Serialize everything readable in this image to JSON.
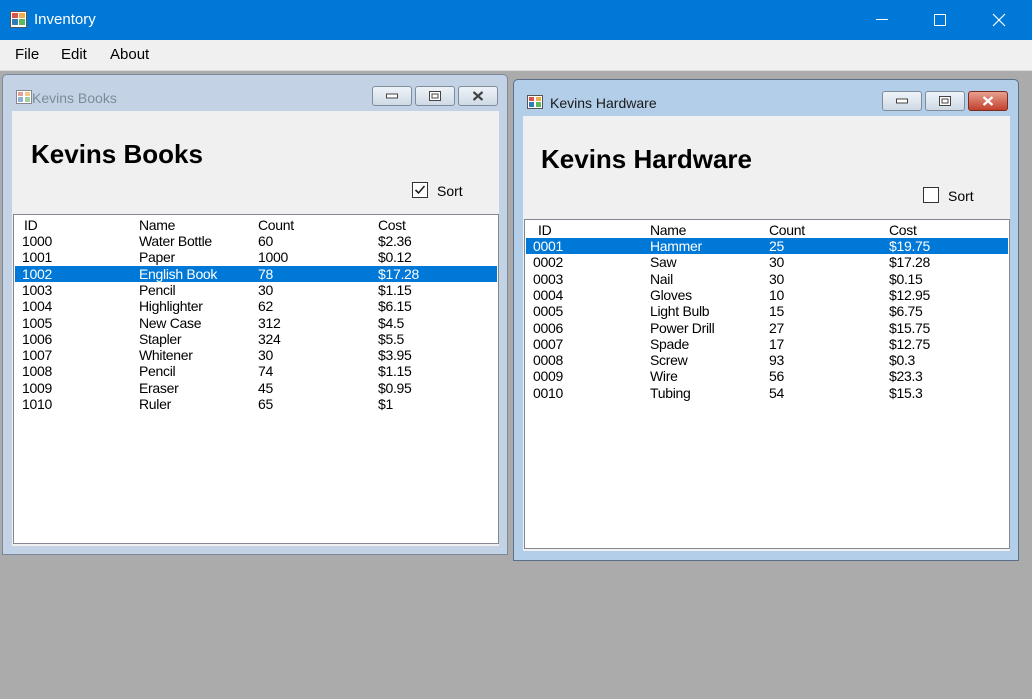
{
  "app": {
    "title": "Inventory"
  },
  "menu": [
    "File",
    "Edit",
    "About"
  ],
  "colors": {
    "titlebar": "#0078d7",
    "selection": "#0078d7",
    "mdi_background": "#ababab"
  },
  "books": {
    "window_title": "Kevins Books",
    "heading": "Kevins Books",
    "sort_label": "Sort",
    "sort_checked": true,
    "columns": [
      "ID",
      "Name",
      "Count",
      "Cost"
    ],
    "selected_index": 2,
    "rows": [
      [
        "1000",
        "Water Bottle",
        "60",
        "$2.36"
      ],
      [
        "1001",
        "Paper",
        "1000",
        "$0.12"
      ],
      [
        "1002",
        "English Book",
        "78",
        "$17.28"
      ],
      [
        "1003",
        "Pencil",
        "30",
        "$1.15"
      ],
      [
        "1004",
        "Highlighter",
        "62",
        "$6.15"
      ],
      [
        "1005",
        "New Case",
        "312",
        "$4.5"
      ],
      [
        "1006",
        "Stapler",
        "324",
        "$5.5"
      ],
      [
        "1007",
        "Whitener",
        "30",
        "$3.95"
      ],
      [
        "1008",
        "Pencil",
        "74",
        "$1.15"
      ],
      [
        "1009",
        "Eraser",
        "45",
        "$0.95"
      ],
      [
        "1010",
        "Ruler",
        "65",
        "$1"
      ]
    ]
  },
  "hardware": {
    "window_title": "Kevins Hardware",
    "heading": "Kevins Hardware",
    "sort_label": "Sort",
    "sort_checked": false,
    "columns": [
      "ID",
      "Name",
      "Count",
      "Cost"
    ],
    "selected_index": 0,
    "rows": [
      [
        "0001",
        "Hammer",
        "25",
        "$19.75"
      ],
      [
        "0002",
        "Saw",
        "30",
        "$17.28"
      ],
      [
        "0003",
        "Nail",
        "30",
        "$0.15"
      ],
      [
        "0004",
        "Gloves",
        "10",
        "$12.95"
      ],
      [
        "0005",
        "Light Bulb",
        "15",
        "$6.75"
      ],
      [
        "0006",
        "Power Drill",
        "27",
        "$15.75"
      ],
      [
        "0007",
        "Spade",
        "17",
        "$12.75"
      ],
      [
        "0008",
        "Screw",
        "93",
        "$0.3"
      ],
      [
        "0009",
        "Wire",
        "56",
        "$23.3"
      ],
      [
        "0010",
        "Tubing",
        "54",
        "$15.3"
      ]
    ]
  }
}
